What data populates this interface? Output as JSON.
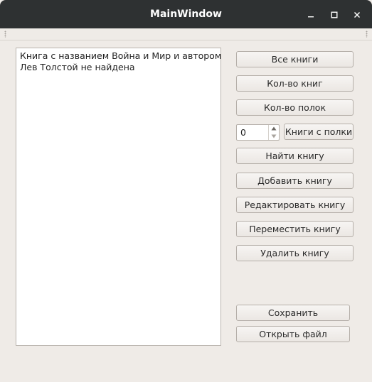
{
  "window": {
    "title": "MainWindow",
    "controls": {
      "minimize_icon": "minimize-icon",
      "maximize_icon": "maximize-icon",
      "close_icon": "close-icon"
    }
  },
  "output": {
    "lines": [
      "Книга с названием Война и Мир и автором",
      "Лев Толстой не найдена"
    ]
  },
  "buttons": {
    "all_books": "Все книги",
    "book_count": "Кол-во книг",
    "shelf_count": "Кол-во полок",
    "books_from_shelf": "Книги с полки",
    "find_book": "Найти книгу",
    "add_book": "Добавить книгу",
    "edit_book": "Редактировать книгу",
    "move_book": "Переместить книгу",
    "delete_book": "Удалить книгу",
    "save": "Сохранить",
    "open_file": "Открыть файл"
  },
  "shelf_spinbox": {
    "value": "0"
  },
  "colors": {
    "titlebar": "#2e3132",
    "window_bg": "#efebe7",
    "text_area_bg": "#ffffff"
  }
}
